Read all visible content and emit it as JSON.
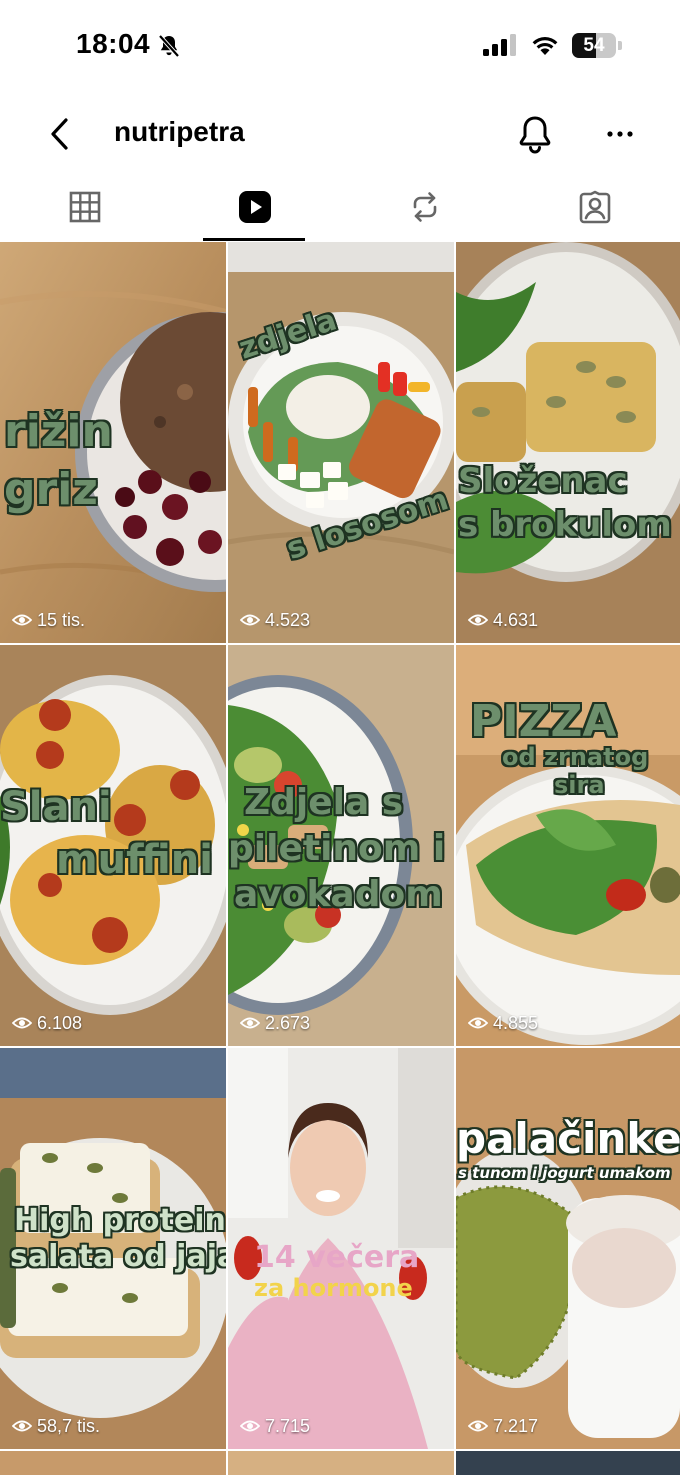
{
  "status_bar": {
    "time": "18:04",
    "battery": "54",
    "battery_level_percent": 54,
    "icons": [
      "bell-slash-icon",
      "signal-icon",
      "wifi-icon",
      "battery-icon"
    ]
  },
  "header": {
    "username": "nutripetra",
    "icons": [
      "chevron-left-icon",
      "bell-icon",
      "more-dots-icon"
    ]
  },
  "tabs": [
    {
      "name": "grid",
      "icon": "grid-icon",
      "active": false
    },
    {
      "name": "reels",
      "icon": "reels-icon",
      "active": true
    },
    {
      "name": "reposts",
      "icon": "repost-icon",
      "active": false
    },
    {
      "name": "tagged",
      "icon": "tagged-person-icon",
      "active": false
    }
  ],
  "reels": [
    {
      "title_lines": [
        "rižin",
        "griz"
      ],
      "views": "15 tis."
    },
    {
      "title_lines": [
        "zdjela",
        "s lososom"
      ],
      "views": "4.523"
    },
    {
      "title_lines": [
        "Složenac",
        "s brokulom"
      ],
      "views": "4.631"
    },
    {
      "title_lines": [
        "Slani",
        "muffini"
      ],
      "views": "6.108"
    },
    {
      "title_lines": [
        "Zdjela s",
        "piletinom i",
        "avokadom"
      ],
      "views": "2.673"
    },
    {
      "title_lines": [
        "PIZZA",
        "od zrnatog",
        "sira"
      ],
      "views": "4.855"
    },
    {
      "title_lines": [
        "High protein",
        "salata od jaja"
      ],
      "views": "58,7 tis."
    },
    {
      "title_lines": [
        "14 večera",
        "za hormone"
      ],
      "views": "7.715"
    },
    {
      "title_lines": [
        "palačinke",
        "s tunom i jogurt umakom"
      ],
      "views": "7.217"
    }
  ],
  "colors": {
    "overlay_text": "#6d8f6c",
    "overlay_outline": "#1e3322",
    "active_tab": "#000000"
  }
}
